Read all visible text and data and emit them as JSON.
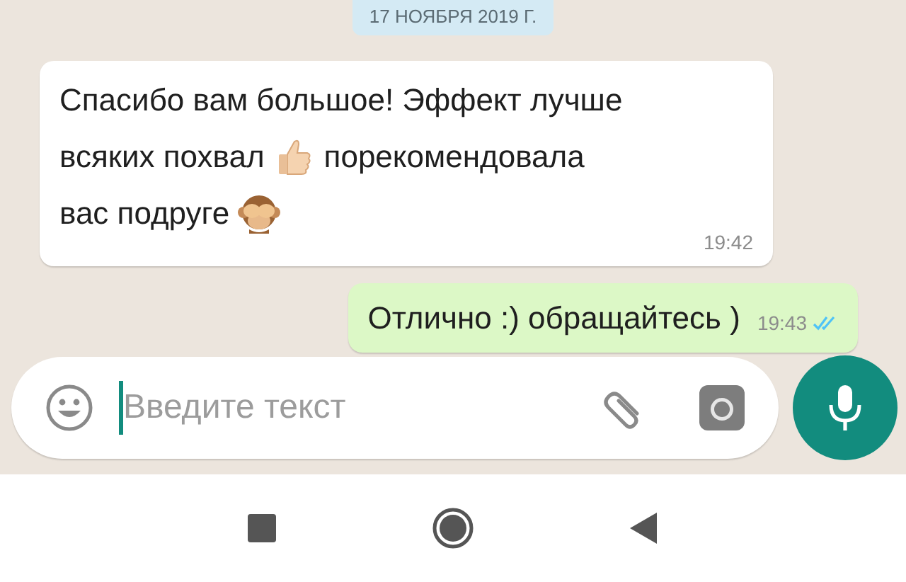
{
  "date_chip": "17 НОЯБРЯ 2019 Г.",
  "messages": [
    {
      "kind": "incoming",
      "parts": [
        {
          "kind": "text",
          "text": "Спасибо вам большое! Эффект лучше"
        },
        {
          "kind": "text",
          "text": "всяких похвал"
        },
        {
          "kind": "thumbs_up"
        },
        {
          "kind": "text",
          "text": "порекомендовала"
        },
        {
          "kind": "text",
          "text": "вас подруге"
        },
        {
          "kind": "monkey"
        }
      ],
      "time": "19:42"
    },
    {
      "kind": "outgoing",
      "parts": [
        {
          "kind": "text",
          "text": "Отлично :) обращайтесь )"
        }
      ],
      "time": "19:43",
      "read": true
    }
  ],
  "composer": {
    "placeholder": "Введите текст"
  }
}
